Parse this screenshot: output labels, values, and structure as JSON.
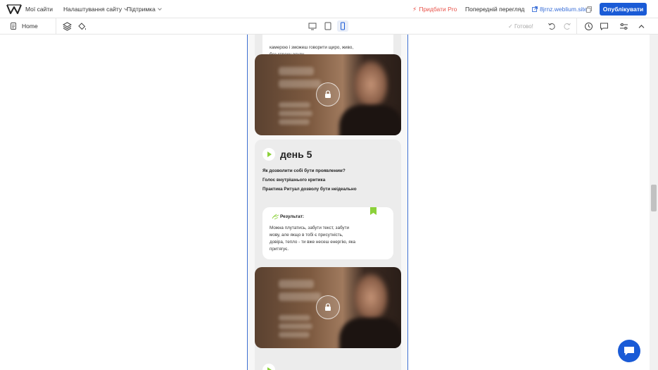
{
  "header": {
    "my_sites": "Мої сайти",
    "site_settings": "Налаштування сайту",
    "support": "Підтримка",
    "add_pro": "Придбати Pro",
    "preview": "Попередній перегляд",
    "site_url": "8jrnz.weblium.site",
    "publish": "Опублікувати"
  },
  "toolbar": {
    "page": "Home",
    "status": "Готово!",
    "active_device": "mobile"
  },
  "content": {
    "prev_note_lines": [
      "камерою і зможеш говорити щиро, живо,",
      "без страху осуду."
    ],
    "day5": {
      "title": "день 5",
      "topics": [
        "Як дозволити собі бути проявленим?",
        "Голос внутрішнього критика",
        "Практика Ритуал дозволу бути неідеально"
      ],
      "result_label": "Результат:",
      "result_lines": [
        "Можна плутатись, забути текст, забути",
        "мову, але якщо в тобі є присутність,",
        "довіра, тепло - ти вже несеш енергію, яка",
        "притягує."
      ]
    }
  },
  "colors": {
    "accent": "#1a5bd6",
    "pro": "#e8534a",
    "green": "#8cd13a"
  }
}
